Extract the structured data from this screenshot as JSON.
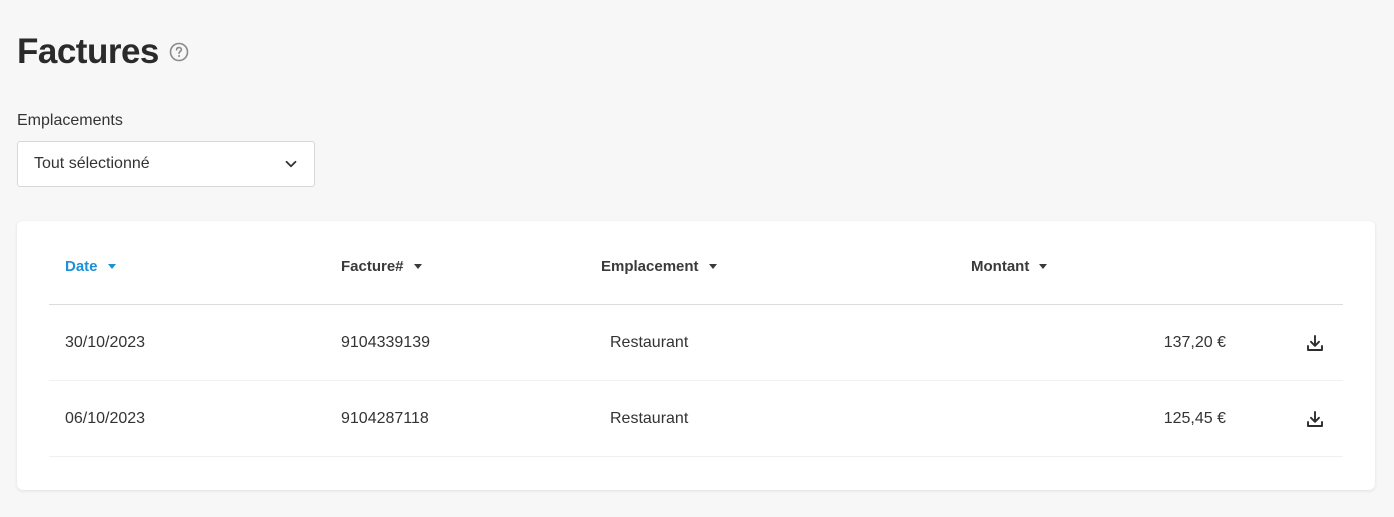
{
  "header": {
    "title": "Factures",
    "help_icon": "help-circle-icon"
  },
  "filter": {
    "label": "Emplacements",
    "selected": "Tout sélectionné",
    "icon": "chevron-down-icon"
  },
  "table": {
    "columns": [
      {
        "label": "Date",
        "active": true
      },
      {
        "label": "Facture#",
        "active": false
      },
      {
        "label": "Emplacement",
        "active": false
      },
      {
        "label": "Montant",
        "active": false
      }
    ],
    "rows": [
      {
        "date": "30/10/2023",
        "invoice": "9104339139",
        "location": "Restaurant",
        "amount": "137,20 €"
      },
      {
        "date": "06/10/2023",
        "invoice": "9104287118",
        "location": "Restaurant",
        "amount": "125,45 €"
      }
    ],
    "row_action_icon": "download-icon"
  },
  "colors": {
    "accent": "#1e90d6",
    "background": "#f7f7f7",
    "card": "#ffffff"
  }
}
